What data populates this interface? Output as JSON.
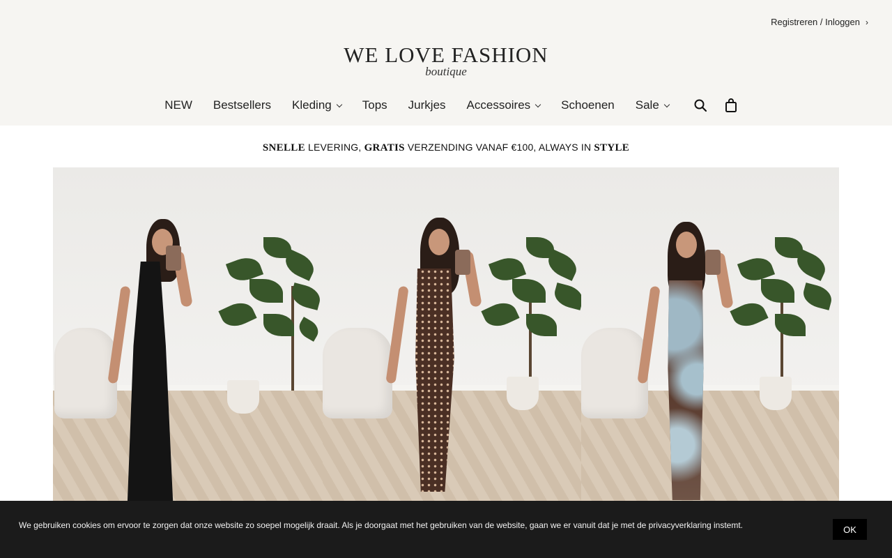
{
  "header": {
    "account_link": "Registreren / Inloggen",
    "logo_main": "WE LOVE FASHION",
    "logo_sub": "boutique"
  },
  "nav": {
    "items": [
      {
        "label": "NEW",
        "has_dropdown": false
      },
      {
        "label": "Bestsellers",
        "has_dropdown": false
      },
      {
        "label": "Kleding",
        "has_dropdown": true
      },
      {
        "label": "Tops",
        "has_dropdown": false
      },
      {
        "label": "Jurkjes",
        "has_dropdown": false
      },
      {
        "label": "Accessoires",
        "has_dropdown": true
      },
      {
        "label": "Schoenen",
        "has_dropdown": false
      },
      {
        "label": "Sale",
        "has_dropdown": true
      }
    ],
    "icons": [
      "search-icon",
      "cart-icon"
    ]
  },
  "promo": {
    "part1": "SNELLE",
    "part2": " LEVERING, ",
    "part3": "GRATIS",
    "part4": " VERZENDING VANAF €100, ALWAYS IN ",
    "part5": "STYLE"
  },
  "gallery": {
    "panels": [
      {
        "dress": "black halter maxi dress"
      },
      {
        "dress": "brown polka dot maxi dress"
      },
      {
        "dress": "tie-dye slip maxi dress"
      }
    ]
  },
  "cookie": {
    "text": "We gebruiken cookies om ervoor te zorgen dat onze website zo soepel mogelijk draait. Als je doorgaat met het gebruiken van de website, gaan we er vanuit dat je met de privacyverklaring instemt.",
    "button": "OK"
  },
  "colors": {
    "header_bg": "#f6f5f2",
    "cookie_bg": "#1b1b1b"
  }
}
